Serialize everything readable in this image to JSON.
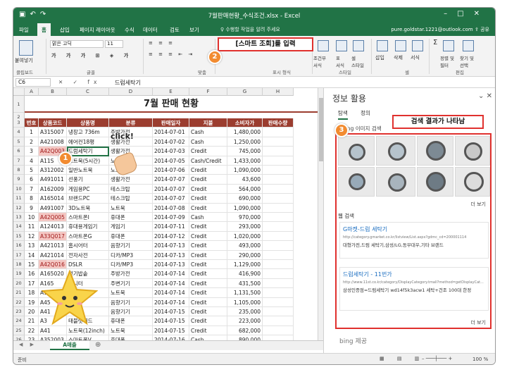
{
  "titlebar": {
    "title": "7월판매현황_수식조건.xlsx - Excel"
  },
  "ribbon_tabs": [
    "파일",
    "홈",
    "삽입",
    "페이지 레이아웃",
    "수식",
    "데이터",
    "검토",
    "보기"
  ],
  "active_tab": "홈",
  "tell_me": "♀ 수행할 작업을 알려 주세요",
  "account": "pure.goldstar.1221@outlook.com",
  "share": "공유",
  "ribbon": {
    "paste": "붙여넣기",
    "clipboard": "클립보드",
    "font_name": "맑은 고딕",
    "font_size": "11",
    "font_group": "글꼴",
    "align_group": "맞춤",
    "number_group": "표시 형식",
    "styles_group": "스타일",
    "cells_group": "셀",
    "edit_group": "편집",
    "cond_format": "조건부\n서식",
    "table_format": "표\n서식",
    "cell_style": "셀\n스타일",
    "insert": "삽입",
    "delete": "삭제",
    "format": "서식",
    "sort": "정렬 및\n필터",
    "find": "찾기 및\n선택"
  },
  "formula_bar": {
    "name_box": "C6",
    "fx": "✕ ✓ fx",
    "value": "드럼세탁기"
  },
  "sheet": {
    "title": "7월 판매 현황",
    "columns": [
      "A",
      "B",
      "C",
      "D",
      "E",
      "F",
      "G",
      "H"
    ],
    "headers": [
      "번호",
      "상품코드",
      "상품명",
      "분류",
      "판매일자",
      "지불",
      "소비자가",
      "판매수량"
    ],
    "rows": [
      [
        "1",
        "A315007",
        "냉장고 736m",
        "주방가전",
        "2014-07-01",
        "Cash",
        "1,480,000",
        ""
      ],
      [
        "2",
        "A421008",
        "에어컨18평",
        "생활가전",
        "2014-07-02",
        "Cash",
        "1,250,000",
        ""
      ],
      [
        "3",
        "A42Q003",
        "드럼세탁기",
        "생활가전",
        "2014-07-03",
        "Credit",
        "745,000",
        ""
      ],
      [
        "4",
        "A11S",
        "노트북(5시간)",
        "노트북",
        "2014-07-05",
        "Cash/Credit",
        "1,433,000",
        ""
      ],
      [
        "5",
        "A312002",
        "일반노트북",
        "노트북",
        "2014-07-06",
        "Credit",
        "1,090,000",
        ""
      ],
      [
        "6",
        "A491011",
        "선풍기",
        "생활가전",
        "2014-07-07",
        "Credit",
        "43,600",
        ""
      ],
      [
        "7",
        "A162009",
        "게임용PC",
        "테스크탑",
        "2014-07-07",
        "Credit",
        "564,000",
        ""
      ],
      [
        "8",
        "A165014",
        "브랜드PC",
        "테스크탑",
        "2014-07-07",
        "Credit",
        "690,000",
        ""
      ],
      [
        "9",
        "A491007",
        "3D노트북",
        "노트북",
        "2014-07-08",
        "Credit",
        "1,090,000",
        ""
      ],
      [
        "10",
        "A42Q005",
        "스마트폰I",
        "휴대폰",
        "2014-07-09",
        "Cash",
        "970,000",
        ""
      ],
      [
        "11",
        "A124013",
        "휴대용게임기",
        "게임기",
        "2014-07-11",
        "Credit",
        "293,000",
        ""
      ],
      [
        "12",
        "A33Q017",
        "스마트폰G",
        "휴대폰",
        "2014-07-12",
        "Credit",
        "1,020,000",
        ""
      ],
      [
        "13",
        "A421013",
        "홈시어터",
        "음향기기",
        "2014-07-13",
        "Credit",
        "493,000",
        ""
      ],
      [
        "14",
        "A421014",
        "전자사전",
        "디카/MP3",
        "2014-07-13",
        "Credit",
        "290,000",
        ""
      ],
      [
        "15",
        "A42Q016",
        "DSLR",
        "디카/MP3",
        "2014-07-13",
        "Credit",
        "1,129,000",
        ""
      ],
      [
        "16",
        "A165020",
        "전기밥솥",
        "주방가전",
        "2014-07-14",
        "Credit",
        "416,900",
        ""
      ],
      [
        "17",
        "A165",
        "모니터",
        "주변기기",
        "2014-07-14",
        "Credit",
        "431,500",
        ""
      ],
      [
        "18",
        "A16",
        "태블릿",
        "노트북",
        "2014-07-14",
        "Credit",
        "1,131,500",
        ""
      ],
      [
        "19",
        "A45",
        "MP3",
        "음향기기",
        "2014-07-14",
        "Credit",
        "1,105,000",
        ""
      ],
      [
        "20",
        "A41",
        "헤드셋",
        "음향기기",
        "2014-07-15",
        "Credit",
        "235,000",
        ""
      ],
      [
        "21",
        "A3",
        "태블릿패드",
        "휴대폰",
        "2014-07-15",
        "Credit",
        "223,000",
        ""
      ],
      [
        "22",
        "A41",
        "노트북(12inch)",
        "노트북",
        "2014-07-15",
        "Credit",
        "682,000",
        ""
      ],
      [
        "23",
        "A352003",
        "스마트폰V",
        "휴대폰",
        "2014-07-16",
        "Cash",
        "890,000",
        ""
      ],
      [
        "24",
        "A16S003",
        "PMP",
        "디카/MP3",
        "2014-07-17",
        "Cash",
        "347,000",
        ""
      ],
      [
        "25",
        "A332022",
        "표준모니터",
        "주변기기",
        "2014-07-19",
        "Credit",
        "217,600",
        ""
      ]
    ],
    "red_rows": [
      2,
      9,
      11,
      14
    ],
    "sheet_tab": "A매출",
    "status_left": "준비",
    "zoom": "100 %"
  },
  "pane": {
    "title": "정보 활용",
    "tabs": [
      "탐색",
      "정의"
    ],
    "image_label": "이미지 검색",
    "image_bing": "bing",
    "more": "더 보기",
    "web_search": "웹 검색",
    "results": [
      {
        "title": "G마켓-드럼 세탁기",
        "url": "http://category.gmarket.co.kr/listview/List.aspx?gdmc_cd=200001114",
        "snippet": "대형가전,드럼 세탁기,삼성/LG,동부대우,기타 브랜드"
      },
      {
        "title": "드럼세탁기 - 11번가",
        "url": "http://www.11st.co.kr/category/DisplayCategory.tmall?method=getDisplayCat...",
        "snippet": "삼성인증점=드럼세탁기 wd14f5k3acw1 세탁+건조 100대 한정"
      }
    ],
    "more2": "더 보기",
    "footer": "bing 제공"
  },
  "callouts": {
    "c1_num": "1",
    "c2_num": "2",
    "c3_num": "3",
    "c2_text": "[스마트 조회]를 입력",
    "c3_text": "검색 결과가 나타남",
    "click": "click!"
  },
  "colors": {
    "excel_green": "#217346",
    "header_red": "#9b3d2f",
    "highlight": "#f4c7c3",
    "callout_red": "#e0312e",
    "badge_orange": "#f28b30"
  }
}
